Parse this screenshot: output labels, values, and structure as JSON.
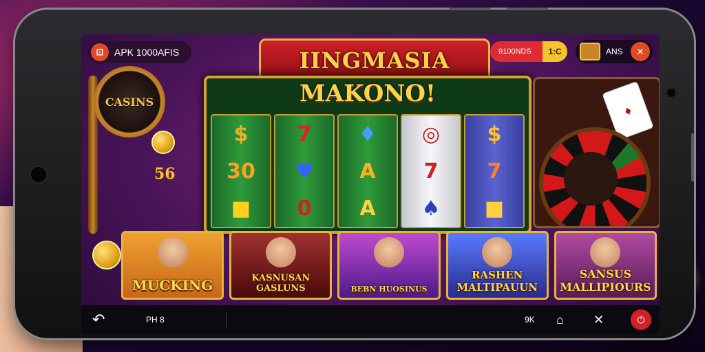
{
  "topbar": {
    "apk_icon": "apk-badge-icon",
    "apk_label": "APK 1000AFIS",
    "bonus_left": "9100NDS",
    "bonus_right": "1:C",
    "chest_icon": "treasure-chest-icon",
    "ans_label": "ANS",
    "close_icon": "x"
  },
  "banner": {
    "title": "IINGMASIA"
  },
  "slot": {
    "title": "MAKONO!",
    "reels": [
      {
        "style": "green",
        "symbols": [
          "$",
          "30",
          "■"
        ]
      },
      {
        "style": "green",
        "symbols": [
          "7",
          "♥",
          "0"
        ]
      },
      {
        "style": "green",
        "symbols": [
          "♦",
          "A",
          "A"
        ]
      },
      {
        "style": "white",
        "symbols": [
          "◎",
          "7",
          "♠"
        ]
      },
      {
        "style": "blue",
        "symbols": [
          "$",
          "7",
          "■"
        ]
      }
    ]
  },
  "left_machine": {
    "wheel_label": "CASINS",
    "side_number": "56"
  },
  "tiles": [
    {
      "label": "MUCKING",
      "bg": "#c7661a"
    },
    {
      "label": "KASNUSAN GASLUNS",
      "bg": "#6a1a1a"
    },
    {
      "label": "BEBN HUOSINUS",
      "bg": "#5a1a8a"
    },
    {
      "label": "RASHEN MALTIPAUUN",
      "bg": "#2a3a9a"
    },
    {
      "label": "SANSUS MALLIPIOURS",
      "bg": "#7a2a6a"
    }
  ],
  "navbar": {
    "back_icon": "↶",
    "left_label": "PH 8",
    "right_label": "9K",
    "home_icon": "⌂",
    "share_icon": "✕",
    "power_icon": "⏻"
  }
}
